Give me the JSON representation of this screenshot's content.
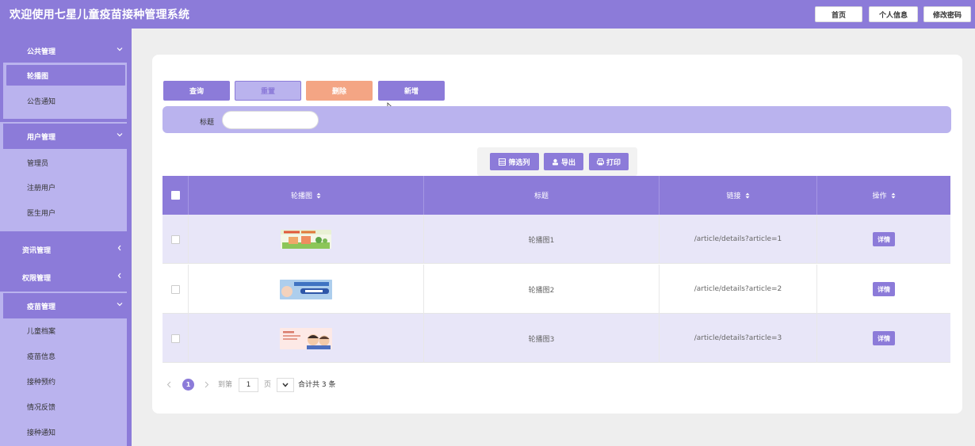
{
  "header": {
    "title": "欢迎使用七星儿童疫苗接种管理系统",
    "buttons": [
      "首页",
      "个人信息",
      "修改密码"
    ]
  },
  "sidebar": {
    "groups": [
      {
        "label": "公共管理",
        "expanded": true,
        "children": [
          "轮播图",
          "公告通知"
        ],
        "active": "轮播图"
      },
      {
        "label": "用户管理",
        "expanded": true,
        "children": [
          "管理员",
          "注册用户",
          "医生用户"
        ]
      },
      {
        "label": "资讯管理",
        "expanded": false,
        "children": []
      },
      {
        "label": "权限管理",
        "expanded": false,
        "children": []
      },
      {
        "label": "疫苗管理",
        "expanded": true,
        "children": [
          "儿童档案",
          "疫苗信息",
          "接种预约",
          "情况反馈",
          "接种通知"
        ]
      }
    ]
  },
  "actions": {
    "query": "查询",
    "reset": "重置",
    "delete": "删除",
    "add": "新增"
  },
  "search": {
    "label": "标题",
    "value": "",
    "placeholder": ""
  },
  "tools": {
    "filter": "筛选列",
    "export": "导出",
    "print": "打印"
  },
  "table": {
    "headers": [
      "轮播图",
      "标题",
      "链接",
      "操作"
    ],
    "rows": [
      {
        "title": "轮播图1",
        "link": "/article/details?article=1",
        "action": "详情"
      },
      {
        "title": "轮播图2",
        "link": "/article/details?article=2",
        "action": "详情"
      },
      {
        "title": "轮播图3",
        "link": "/article/details?article=3",
        "action": "详情"
      }
    ]
  },
  "pagination": {
    "current": "1",
    "goto_label": "到第",
    "page_value": "1",
    "page_unit": "页",
    "total_text": "合计共 3 条"
  },
  "colors": {
    "primary": "#8c7bd9",
    "light": "#bab3ee",
    "reset_bg": "#bab3ee",
    "delete_bg": "#f4a584",
    "row_alt": "#e8e6f8"
  }
}
